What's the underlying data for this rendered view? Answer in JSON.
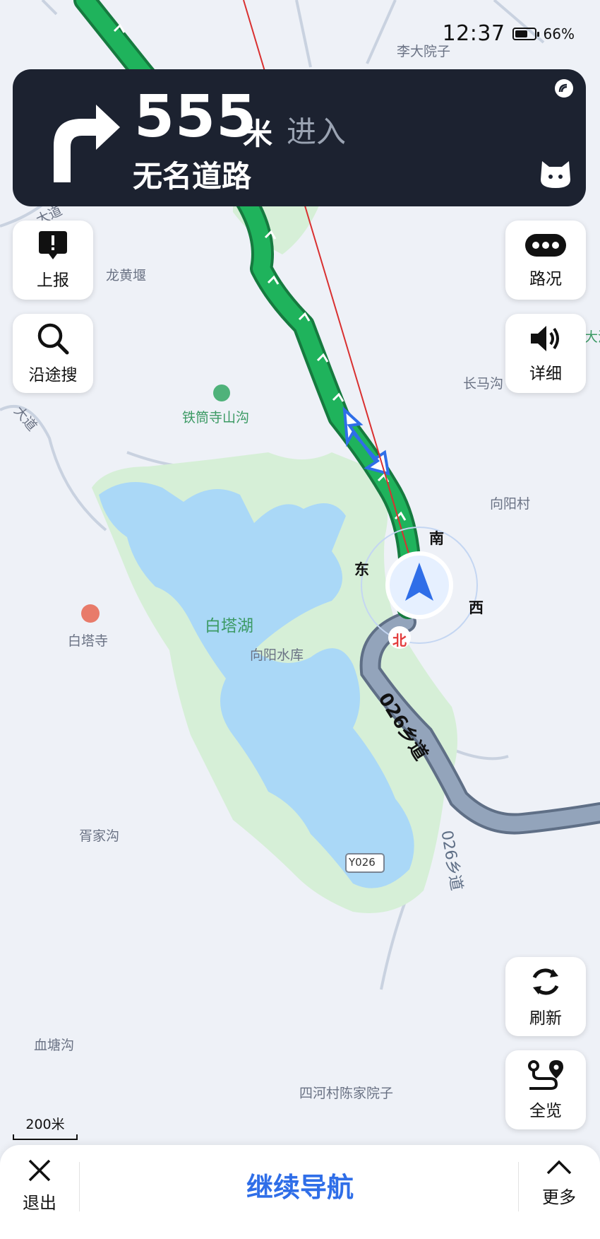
{
  "status_bar": {
    "time": "12:37",
    "battery_pct": "66%",
    "battery_level": 0.66
  },
  "guidance": {
    "distance": "555",
    "unit": "米",
    "action": "进入",
    "road": "无名道路"
  },
  "left_buttons": [
    {
      "label": "上报"
    },
    {
      "label": "沿途搜"
    }
  ],
  "right_buttons": [
    {
      "label": "路况"
    },
    {
      "label": "详细"
    },
    {
      "label": "刷新"
    },
    {
      "label": "全览"
    }
  ],
  "map": {
    "places": [
      "李大院子",
      "龙黄堰",
      "铁筒寺山沟",
      "长马沟",
      "向阳村",
      "白塔湖",
      "向阳水库",
      "白塔寺",
      "胥家沟",
      "血塘沟",
      "四河村陈家院子",
      "大道",
      "大道",
      "大池"
    ],
    "road_label": "026乡道",
    "road_label_2": "026乡道",
    "route_badge": "Y026",
    "compass": {
      "north": "北",
      "south": "南",
      "east": "东",
      "west": "西"
    },
    "scale": "200米"
  },
  "bottom_bar": {
    "exit": "退出",
    "continue": "继续导航",
    "more": "更多"
  },
  "colors": {
    "route_green": "#1fb35c",
    "panel_bg": "#1c2230",
    "water": "#aad8f7",
    "green_area": "#d6efd7",
    "road_gray": "#8d9db3",
    "accent_blue": "#2f6ee8",
    "north_red": "#e33b3b"
  },
  "icons": [
    "turn-right-icon",
    "voice-signal-icon",
    "cat-assistant-icon",
    "report-icon",
    "search-icon",
    "traffic-icon",
    "speaker-icon",
    "refresh-icon",
    "overview-icon",
    "close-icon",
    "chevron-up-icon",
    "nav-arrow-icon",
    "poi-marker-icon",
    "temple-icon"
  ]
}
